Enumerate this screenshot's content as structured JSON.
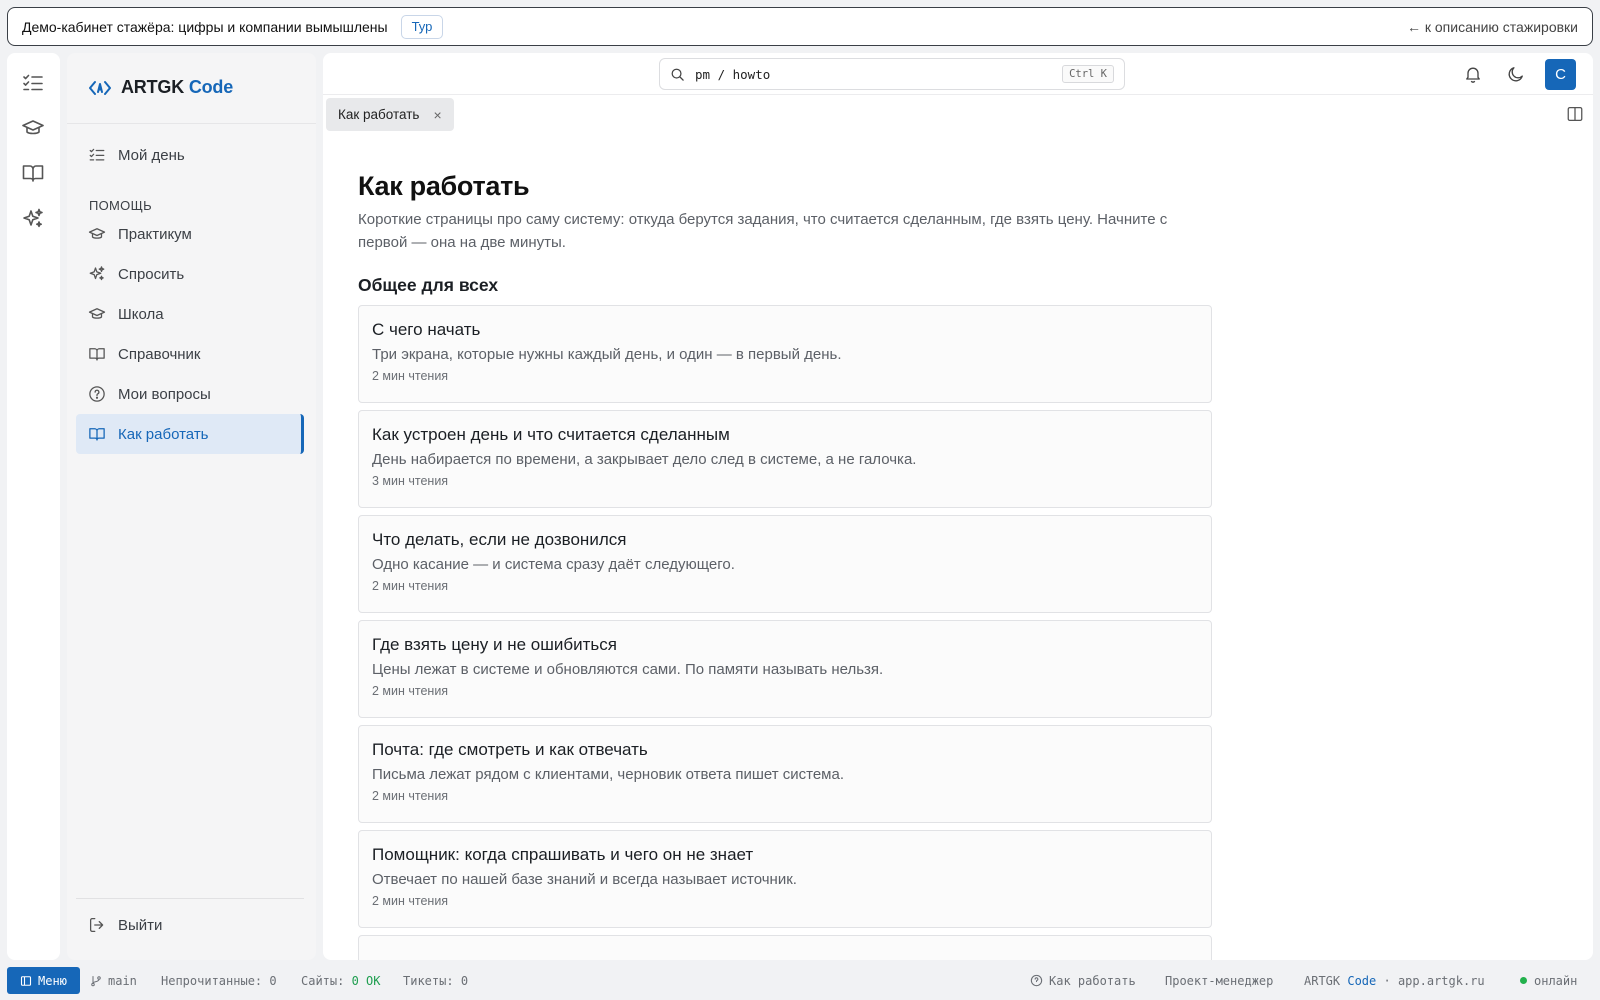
{
  "banner": {
    "text": "Демо-кабинет стажёра: цифры и компании вымышлены",
    "tour_label": "Тур",
    "back_link": "← к описанию стажировки"
  },
  "rail": {
    "icons": [
      "checklist-icon",
      "graduation-cap-icon",
      "book-icon",
      "sparkles-icon"
    ]
  },
  "sidebar": {
    "logo_main": "ARTGK",
    "logo_accent": "Code",
    "my_day": "Мой день",
    "section_label": "ПОМОЩЬ",
    "items": [
      {
        "label": "Практикум",
        "icon": "graduation-cap-icon"
      },
      {
        "label": "Спросить",
        "icon": "sparkles-icon"
      },
      {
        "label": "Школа",
        "icon": "graduation-cap-icon"
      },
      {
        "label": "Справочник",
        "icon": "book-icon"
      },
      {
        "label": "Мои вопросы",
        "icon": "question-circle-icon"
      },
      {
        "label": "Как работать",
        "icon": "book-icon",
        "active": true
      }
    ],
    "logout": "Выйти"
  },
  "topbar": {
    "search_path": "pm / howto",
    "search_shortcut": "Ctrl K",
    "avatar_letter": "С"
  },
  "tabs": [
    {
      "label": "Как работать"
    }
  ],
  "page": {
    "title": "Как работать",
    "description": "Короткие страницы про саму систему: откуда берутся задания, что считается сделанным, где взять цену. Начните с первой — она на две минуты.",
    "section_title": "Общее для всех",
    "cards": [
      {
        "title": "С чего начать",
        "desc": "Три экрана, которые нужны каждый день, и один — в первый день.",
        "meta": "2 мин чтения"
      },
      {
        "title": "Как устроен день и что считается сделанным",
        "desc": "День набирается по времени, а закрывает дело след в системе, а не галочка.",
        "meta": "3 мин чтения"
      },
      {
        "title": "Что делать, если не дозвонился",
        "desc": "Одно касание — и система сразу даёт следующего.",
        "meta": "2 мин чтения"
      },
      {
        "title": "Где взять цену и не ошибиться",
        "desc": "Цены лежат в системе и обновляются сами. По памяти называть нельзя.",
        "meta": "2 мин чтения"
      },
      {
        "title": "Почта: где смотреть и как отвечать",
        "desc": "Письма лежат рядом с клиентами, черновик ответа пишет система.",
        "meta": "2 мин чтения"
      },
      {
        "title": "Помощник: когда спрашивать и чего он не знает",
        "desc": "Отвечает по нашей базе знаний и всегда называет источник.",
        "meta": "2 мин чтения"
      }
    ]
  },
  "statusbar": {
    "menu": "Меню",
    "branch": "main",
    "unread_label": "Непрочитанные:",
    "unread_value": "0",
    "sites_label": "Сайты:",
    "sites_value": "0 OK",
    "tickets_label": "Тикеты:",
    "tickets_value": "0",
    "help": "Как работать",
    "role": "Проект-менеджер",
    "brand_main": "ARTGK",
    "brand_accent": "Code",
    "domain": "· app.artgk.ru",
    "online": "онлайн"
  },
  "colors": {
    "accent": "#1667b8",
    "online": "#22b14c"
  }
}
